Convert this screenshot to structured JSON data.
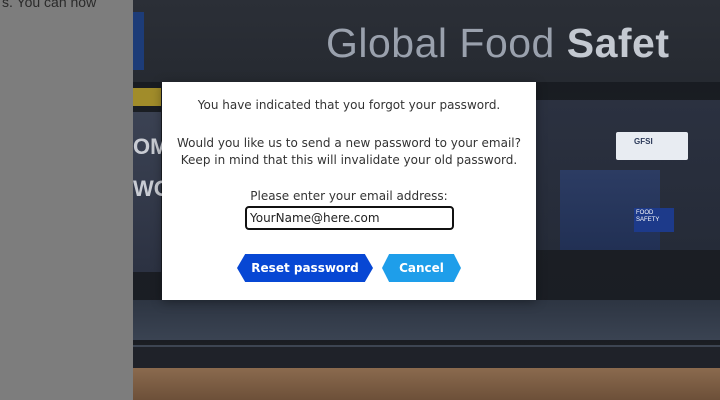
{
  "left_panel": {
    "partial_text": "s. You can now"
  },
  "background": {
    "banner_title_regular": "Global Food ",
    "banner_title_bold": "Safet",
    "booth_text_line1": "OM",
    "booth_text_line2": "WO",
    "gfsi_sign": "GFSI",
    "food_safety_sign": "FOOD SAFETY"
  },
  "dialog": {
    "line1": "You have indicated that you forgot your password.",
    "line2": "Would you like us to send a new password to your email?",
    "line3": "Keep in mind that this will invalidate your old password.",
    "email_label": "Please enter your email address:",
    "email_value": "YourName@here.com",
    "reset_button": "Reset password",
    "cancel_button": "Cancel"
  },
  "colors": {
    "reset_button": "#0747d4",
    "cancel_button": "#1e9eea",
    "overlay": "#7d7d7d"
  }
}
